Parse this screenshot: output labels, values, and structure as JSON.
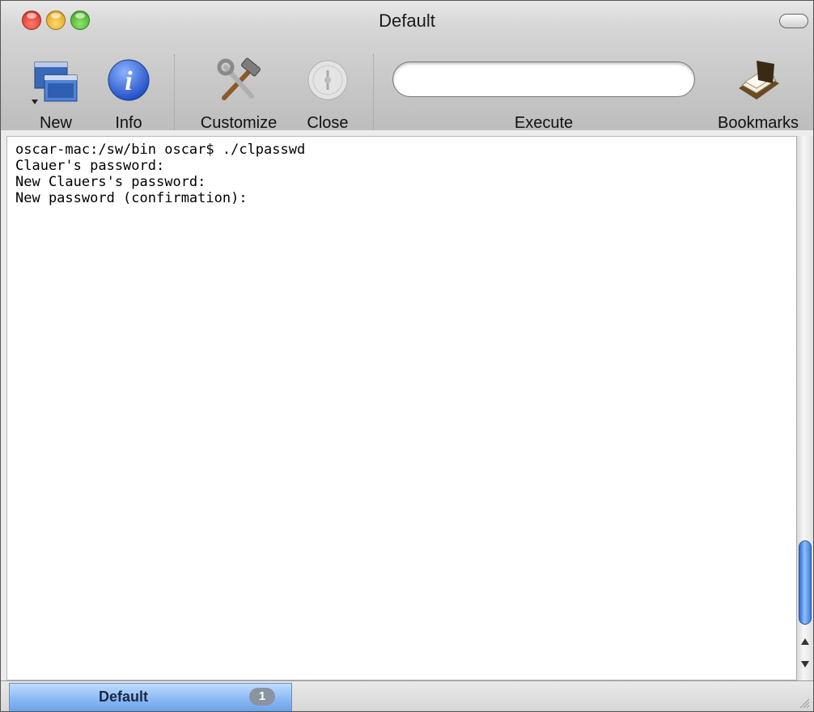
{
  "window": {
    "title": "Default"
  },
  "toolbar": {
    "new_label": "New",
    "info_label": "Info",
    "customize_label": "Customize",
    "close_label": "Close",
    "execute_label": "Execute",
    "execute_value": "",
    "bookmarks_label": "Bookmarks"
  },
  "terminal": {
    "lines": [
      "oscar-mac:/sw/bin oscar$ ./clpasswd",
      "Clauer's password:",
      "New Clauers's password:",
      "New password (confirmation):"
    ]
  },
  "tabs": [
    {
      "label": "Default",
      "badge": "1"
    }
  ],
  "colors": {
    "tab_selected": "#86b6f2",
    "scroll_thumb": "#3f7fda"
  },
  "icons": [
    "new-window-icon",
    "info-icon",
    "customize-icon",
    "close-icon",
    "bookmarks-icon"
  ]
}
